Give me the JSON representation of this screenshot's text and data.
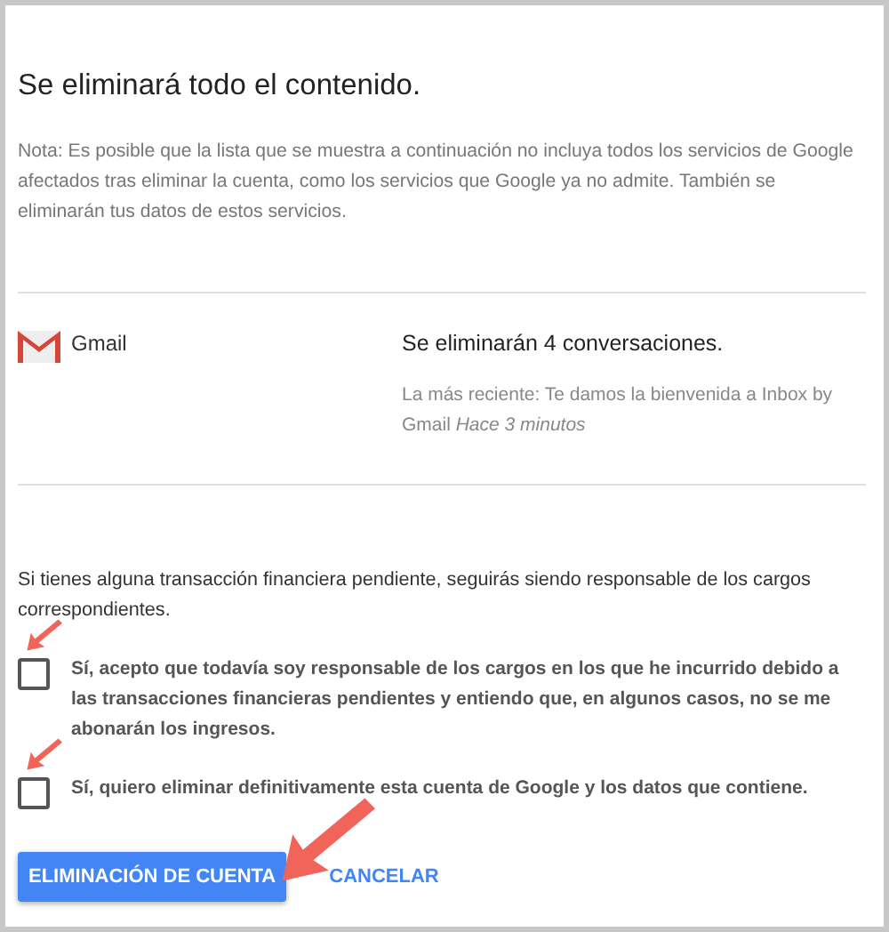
{
  "heading": "Se eliminará todo el contenido.",
  "note": "Nota: Es posible que la lista que se muestra a continuación no incluya todos los servicios de Google afectados tras eliminar la cuenta, como los servicios que Google ya no admite. También se eliminarán tus datos de estos servicios.",
  "services": [
    {
      "name": "Gmail",
      "summary": "Se eliminarán 4 conversaciones.",
      "detail": "La más reciente: Te damos la bienvenida a Inbox by Gmail *Hace 3 minutos*"
    }
  ],
  "warning": "Si tienes alguna transacción financiera pendiente, seguirás siendo responsable de los cargos correspondientes.",
  "confirmations": [
    {
      "label": "Sí, acepto que todavía soy responsable de los cargos en los que he incurrido debido a las transacciones financieras pendientes y entiendo que, en algunos casos, no se me abonarán los ingresos.",
      "checked": false
    },
    {
      "label": "Sí, quiero eliminar definitivamente esta cuenta de Google y los datos que contiene.",
      "checked": false
    }
  ],
  "buttons": [
    {
      "label": "ELIMINACIÓN DE CUENTA",
      "kind": "primary"
    },
    {
      "label": "CANCELAR",
      "kind": "text"
    }
  ]
}
